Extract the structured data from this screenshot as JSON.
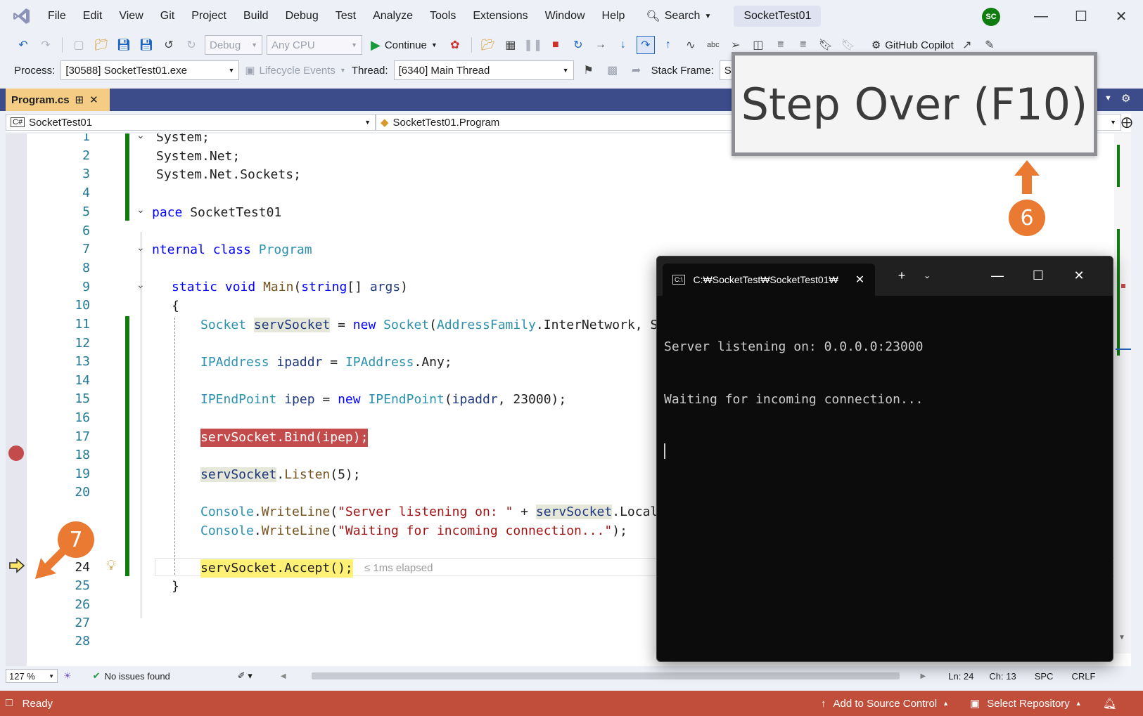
{
  "menubar": {
    "items": [
      "File",
      "Edit",
      "View",
      "Git",
      "Project",
      "Build",
      "Debug",
      "Test",
      "Analyze",
      "Tools",
      "Extensions",
      "Window",
      "Help"
    ],
    "search_label": "Search",
    "window_title": "SocketTest01",
    "avatar_initials": "SC"
  },
  "toolbar": {
    "config": "Debug",
    "platform": "Any CPU",
    "continue_label": "Continue",
    "copilot_label": "GitHub Copilot",
    "process_label": "Process:",
    "process_value": "[30588] SocketTest01.exe",
    "lifecycle_label": "Lifecycle Events",
    "thread_label": "Thread:",
    "thread_value": "[6340] Main Thread",
    "stackframe_label": "Stack Frame:",
    "stackframe_value": "Soc"
  },
  "document_tab": {
    "name": "Program.cs"
  },
  "navbar": {
    "project": "SocketTest01",
    "class": "SocketTest01.Program"
  },
  "editor": {
    "line_numbers": [
      "1",
      "2",
      "3",
      "4",
      "5",
      "6",
      "7",
      "8",
      "9",
      "10",
      "11",
      "12",
      "13",
      "14",
      "15",
      "16",
      "17",
      "18",
      "19",
      "20",
      "23",
      "24",
      "25",
      "26",
      "27",
      "28"
    ],
    "elapsed": "≤ 1ms elapsed"
  },
  "callout": {
    "text": "Step Over (F10)",
    "badge_top": "6",
    "badge_left": "7"
  },
  "console": {
    "tab_title": "C:₩SocketTest₩SocketTest01₩",
    "lines": [
      "Server listening on: 0.0.0.0:23000",
      "Waiting for incoming connection..."
    ]
  },
  "editor_status": {
    "zoom": "127 %",
    "issues": "No issues found",
    "ln": "Ln: 24",
    "ch": "Ch: 13",
    "spc": "SPC",
    "crlf": "CRLF"
  },
  "app_status": {
    "ready": "Ready",
    "source_control": "Add to Source Control",
    "repository": "Select Repository",
    "notifications": "1"
  },
  "colors": {
    "status_bar": "#c14e3b",
    "tab_active": "#f5cc84",
    "badge": "#ea7932",
    "breakpoint": "#c34b4b",
    "current_line": "#fff176"
  }
}
